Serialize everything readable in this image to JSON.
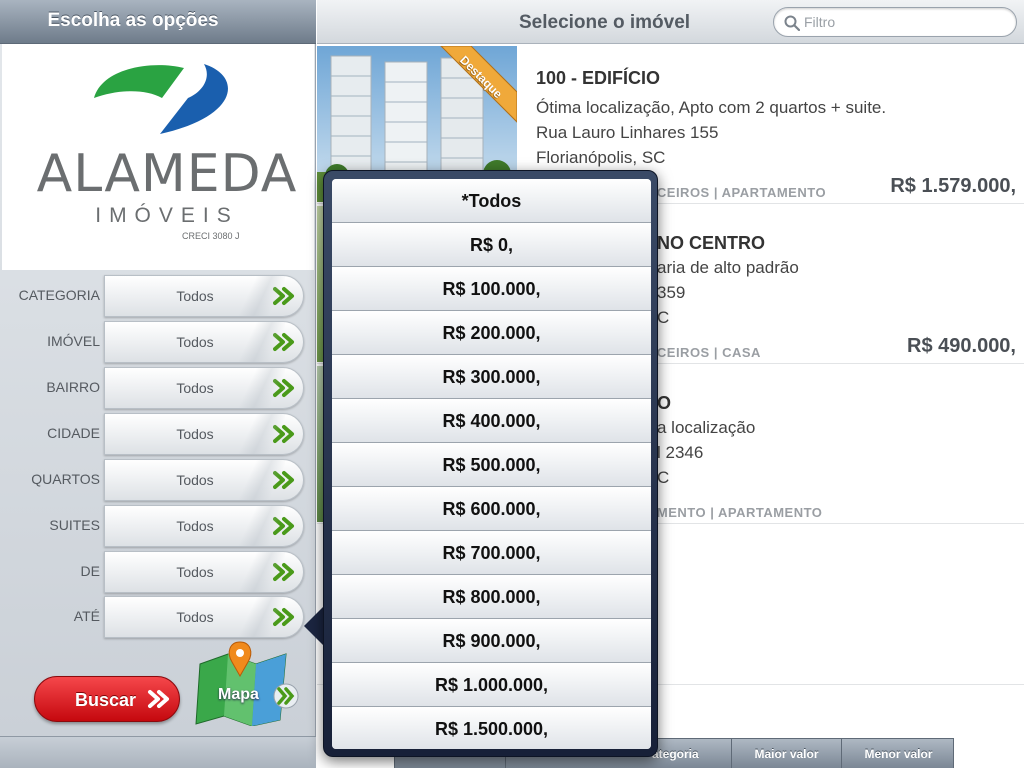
{
  "sidebar": {
    "title": "Escolha as opções",
    "logo": {
      "name": "ALAMEDA",
      "sub": "IMÓVEIS",
      "creci": "CRECI 3080 J"
    },
    "filters": [
      {
        "label": "CATEGORIA",
        "value": "Todos"
      },
      {
        "label": "IMÓVEL",
        "value": "Todos"
      },
      {
        "label": "BAIRRO",
        "value": "Todos"
      },
      {
        "label": "CIDADE",
        "value": "Todos"
      },
      {
        "label": "QUARTOS",
        "value": "Todos"
      },
      {
        "label": "SUITES",
        "value": "Todos"
      },
      {
        "label": "DE",
        "value": "Todos"
      },
      {
        "label": "ATÉ",
        "value": "Todos"
      }
    ],
    "search_button": "Buscar",
    "map_button": "Mapa"
  },
  "header": {
    "title": "Selecione o imóvel",
    "search_placeholder": "Filtro"
  },
  "listings": [
    {
      "name": "100 - EDIFÍCIO",
      "desc": "Ótima localização, Apto com 2 quartos + suite.",
      "address": "Rua Lauro Linhares 155",
      "city": "Florianópolis, SC",
      "tags": "RCEIROS   |   APARTAMENTO",
      "price": "R$ 1.579.000,",
      "badge": "Destaque"
    },
    {
      "name": "NO CENTRO",
      "desc": "aria de alto padrão",
      "address": "359",
      "city": "C",
      "tags": "RCEIROS   |   CASA",
      "price": "R$ 490.000,"
    },
    {
      "name": "O",
      "desc": "a localização",
      "address": "l 2346",
      "city": "C",
      "tags": "AMENTO   |   APARTAMENTO",
      "price": ""
    }
  ],
  "sort_tabs": [
    "ategoria",
    "Maior valor",
    "Menor valor"
  ],
  "price_picker": {
    "options": [
      "*Todos",
      "R$ 0,",
      "R$ 100.000,",
      "R$ 200.000,",
      "R$ 300.000,",
      "R$ 400.000,",
      "R$ 500.000,",
      "R$ 600.000,",
      "R$ 700.000,",
      "R$ 800.000,",
      "R$ 900.000,",
      "R$ 1.000.000,",
      "R$ 1.500.000,"
    ]
  },
  "colors": {
    "accent_red": "#d0121a",
    "logo_green": "#2aa342",
    "logo_blue": "#1a5fae",
    "chevron_green": "#4a9a1a"
  }
}
